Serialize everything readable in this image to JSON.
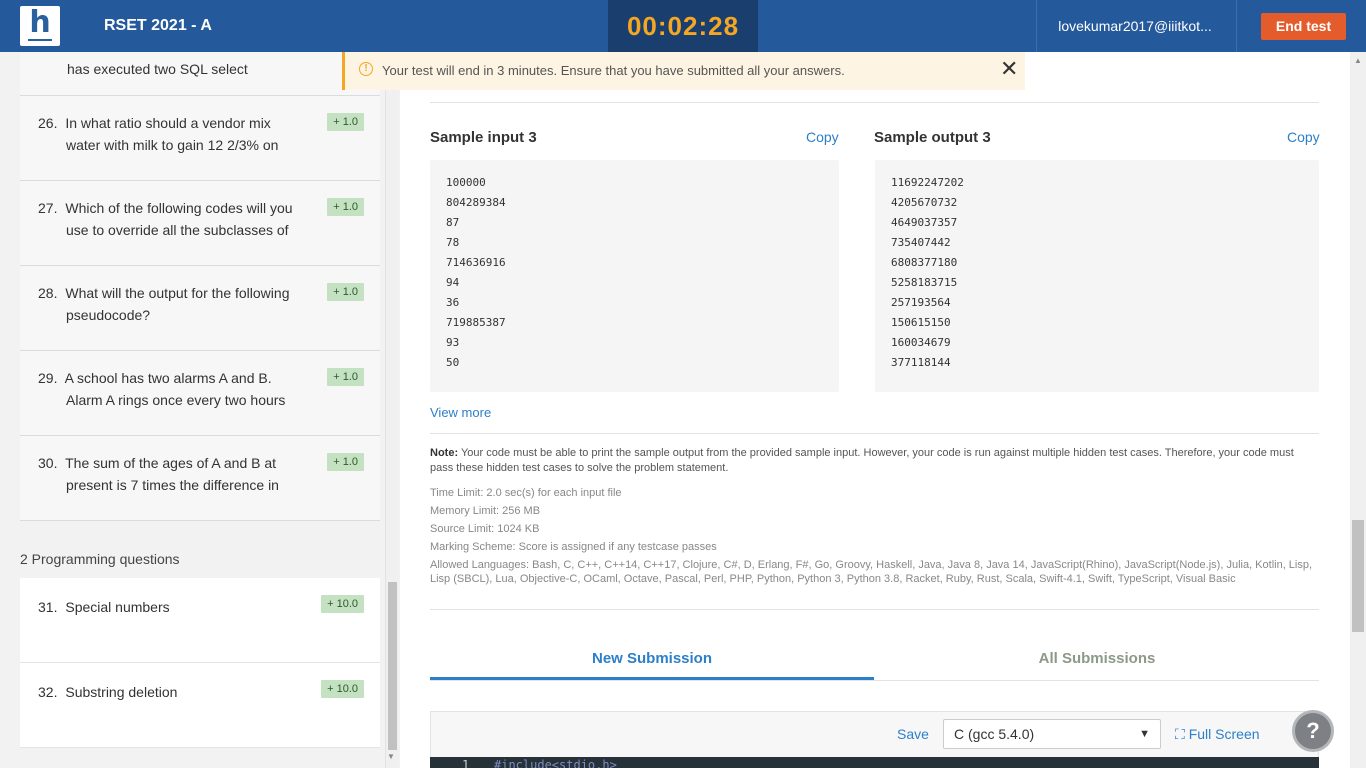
{
  "header": {
    "logo_letter": "h",
    "test_title": "RSET 2021 - A",
    "timer": "00:02:28",
    "user_email": "lovekumar2017@iiitkot...",
    "end_test_label": "End test"
  },
  "toast": {
    "icon": "!",
    "message": "Your test will end in 3 minutes. Ensure that you have submitted all your answers.",
    "close": "✕"
  },
  "sidebar": {
    "partial_item_text": "has executed two SQL select",
    "questions": [
      {
        "num": "26.",
        "line1": "In what ratio should a vendor mix",
        "line2": "water with milk to gain 12 2/3% on",
        "score": "+ 1.0"
      },
      {
        "num": "27.",
        "line1": "Which of the following codes will you",
        "line2": "use to override all the subclasses of",
        "score": "+ 1.0"
      },
      {
        "num": "28.",
        "line1": "What will the output for the following",
        "line2": "pseudocode?",
        "score": "+ 1.0"
      },
      {
        "num": "29.",
        "line1": "A school has two alarms A and B.",
        "line2": "Alarm A rings once every two hours",
        "score": "+ 1.0"
      },
      {
        "num": "30.",
        "line1": "The sum of the ages of A and B at",
        "line2": "present is 7 times the difference in",
        "score": "+ 1.0"
      }
    ],
    "programming_section_title": "2 Programming questions",
    "programming": [
      {
        "num": "31.",
        "title": "Special numbers",
        "score": "+ 10.0"
      },
      {
        "num": "32.",
        "title": "Substring deletion",
        "score": "+ 10.0"
      }
    ]
  },
  "sample": {
    "input_title": "Sample input 3",
    "output_title": "Sample output 3",
    "copy_label": "Copy",
    "input_lines": [
      "100000",
      "804289384",
      "87",
      "78",
      "714636916",
      "94",
      "36",
      "719885387",
      "93",
      "50"
    ],
    "output_lines": [
      "11692247202",
      "4205670732",
      "4649037357",
      "735407442",
      "6808377180",
      "5258183715",
      "257193564",
      "150615150",
      "160034679",
      "377118144"
    ],
    "view_more": "View more"
  },
  "note": {
    "label": "Note:",
    "text": "Your code must be able to print the sample output from the provided sample input. However, your code is run against multiple hidden test cases. Therefore, your code must pass these hidden test cases to solve the problem statement."
  },
  "limits": {
    "time": "Time Limit: 2.0 sec(s) for each input file",
    "memory": "Memory Limit: 256 MB",
    "source": "Source Limit: 1024 KB",
    "marking": "Marking Scheme: Score is assigned if any testcase passes",
    "languages": "Allowed Languages: Bash, C, C++, C++14, C++17, Clojure, C#, D, Erlang, F#, Go, Groovy, Haskell, Java, Java 8, Java 14, JavaScript(Rhino), JavaScript(Node.js), Julia, Kotlin, Lisp, Lisp (SBCL), Lua, Objective-C, OCaml, Octave, Pascal, Perl, PHP, Python, Python 3, Python 3.8, Racket, Ruby, Rust, Scala, Swift-4.1, Swift, TypeScript, Visual Basic"
  },
  "tabs": {
    "new_submission": "New Submission",
    "all_submissions": "All Submissions"
  },
  "editor": {
    "save_label": "Save",
    "language": "C (gcc 5.4.0)",
    "fullscreen_label": "Full Screen",
    "first_line_number": "1",
    "first_line_code": "#include<stdio.h>"
  },
  "help": {
    "label": "?"
  },
  "icons": {
    "warning": "warning-icon",
    "close": "close-icon",
    "fullscreen": "fullscreen-icon",
    "settings": "gear-icon",
    "help": "help-icon"
  },
  "colors": {
    "header_bg": "#24599c",
    "timer_bg": "#1a3f6f",
    "timer_text": "#f5a623",
    "end_button": "#e45b2c",
    "link_blue": "#2c7fc9",
    "score_badge": "#c4e1c1"
  }
}
